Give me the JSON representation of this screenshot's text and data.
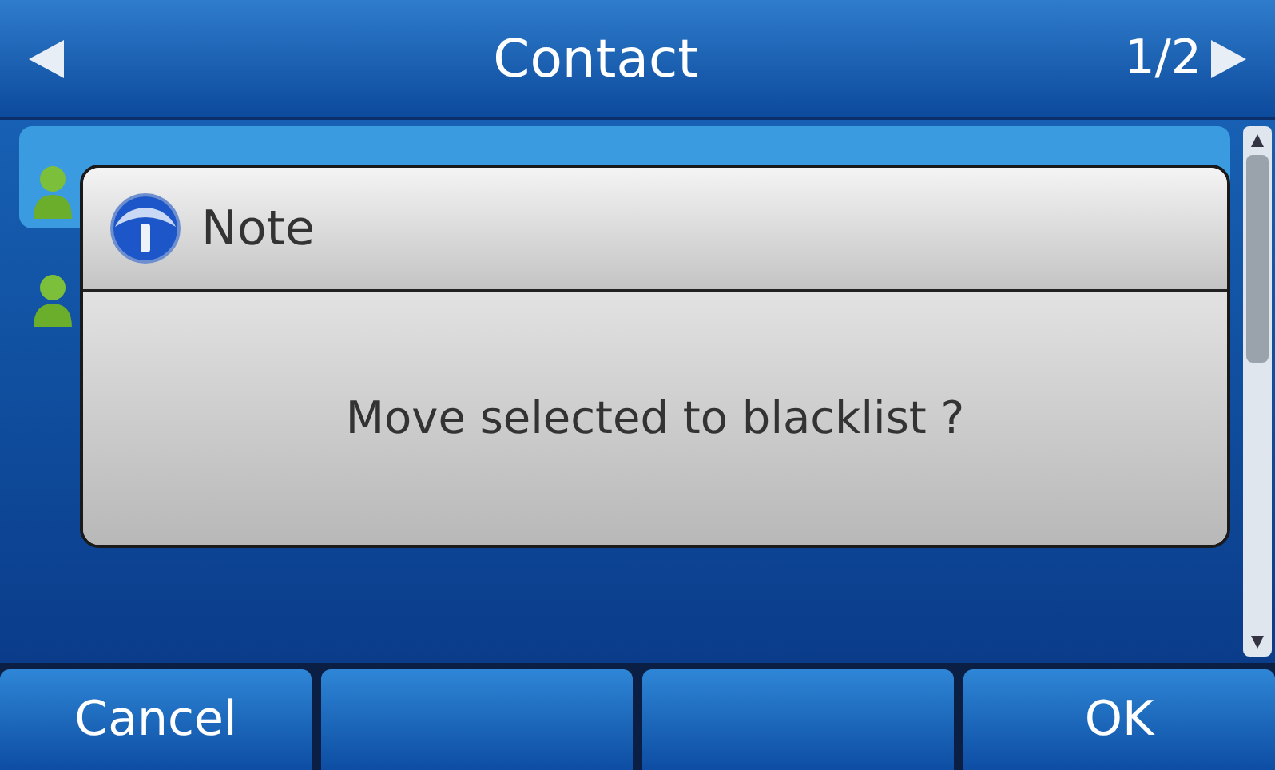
{
  "header": {
    "title": "Contact",
    "page": "1/2"
  },
  "contacts": [
    {
      "selected": true
    },
    {
      "selected": false
    }
  ],
  "dialog": {
    "title": "Note",
    "message": "Move selected to blacklist ?"
  },
  "softkeys": [
    {
      "kind": "label",
      "label": "Cancel"
    },
    {
      "kind": "blank"
    },
    {
      "kind": "blank"
    },
    {
      "kind": "label",
      "label": "OK"
    }
  ]
}
